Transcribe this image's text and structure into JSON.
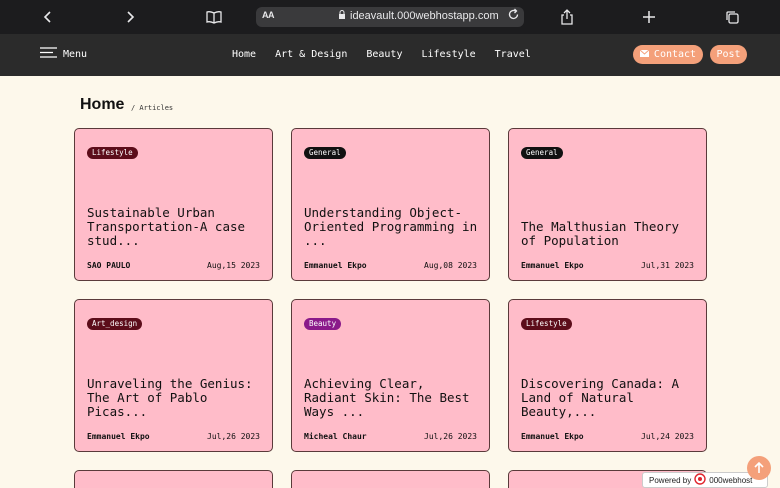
{
  "browser": {
    "url": "ideavault.000webhostapp.com",
    "aa_label": "AA",
    "icons": [
      "chevron-left-icon",
      "chevron-right-icon",
      "book-icon",
      "lock-icon",
      "reload-icon",
      "share-icon",
      "plus-icon",
      "tabs-icon"
    ]
  },
  "nav": {
    "menu_label": "Menu",
    "links": [
      "Home",
      "Art & Design",
      "Beauty",
      "Lifestyle",
      "Travel"
    ],
    "contact_label": "Contact",
    "post_label": "Post"
  },
  "breadcrumb": {
    "title": "Home",
    "sub": "/ Articles"
  },
  "articles": [
    {
      "tag": "Lifestyle",
      "tag_color": "#5c0d1a",
      "title": "Sustainable Urban Transportation-A case stud...",
      "author": "SAO PAULO",
      "date": "Aug,15 2023"
    },
    {
      "tag": "General",
      "tag_color": "#111111",
      "title": "Understanding Object-Oriented Programming in ...",
      "author": "Emmanuel Ekpo",
      "date": "Aug,08 2023"
    },
    {
      "tag": "General",
      "tag_color": "#111111",
      "title": "The Malthusian Theory of Population",
      "author": "Emmanuel Ekpo",
      "date": "Jul,31 2023"
    },
    {
      "tag": "Art_design",
      "tag_color": "#5c0d1a",
      "title": "Unraveling the Genius: The Art of Pablo Picas...",
      "author": "Emmanuel Ekpo",
      "date": "Jul,26 2023"
    },
    {
      "tag": "Beauty",
      "tag_color": "#8a1a8a",
      "title": "Achieving Clear, Radiant Skin: The Best Ways ...",
      "author": "Micheal Chaur",
      "date": "Jul,26 2023"
    },
    {
      "tag": "Lifestyle",
      "tag_color": "#5c0d1a",
      "title": "Discovering Canada: A Land of Natural Beauty,...",
      "author": "Emmanuel Ekpo",
      "date": "Jul,24 2023"
    }
  ],
  "powered": {
    "prefix": "Powered by",
    "brand": "000webhost"
  },
  "colors": {
    "page_bg": "#fdf8eb",
    "nav_bg": "#2b2b2b",
    "accent": "#f4a07a",
    "card_bg": "#ffbcc9"
  }
}
